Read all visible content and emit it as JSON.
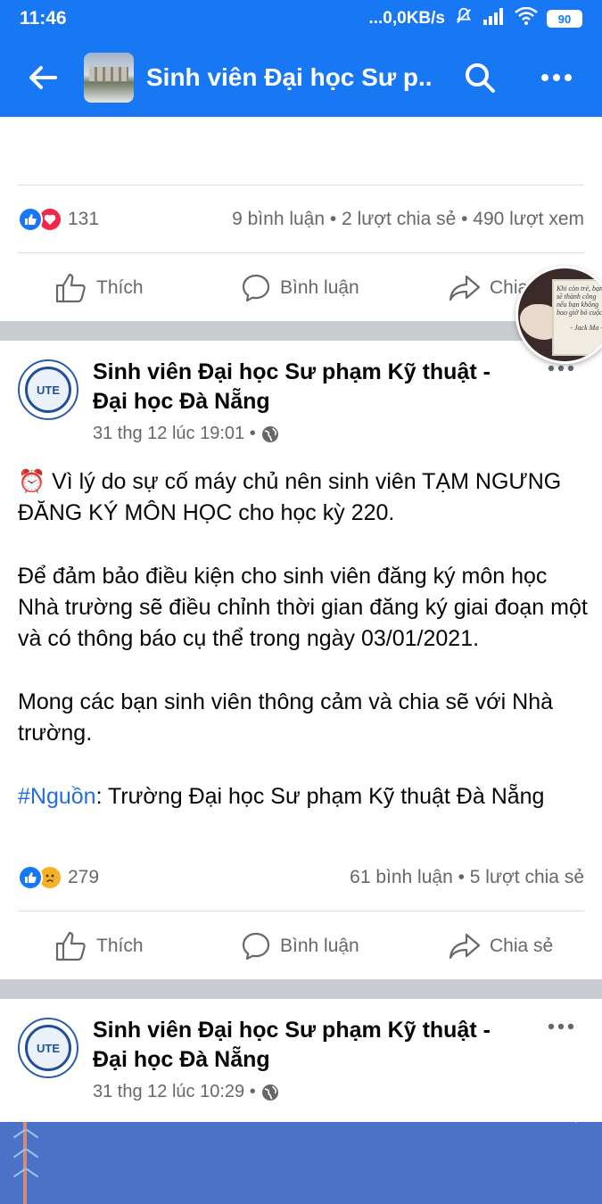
{
  "status_bar": {
    "time": "11:46",
    "network_speed": "...0,0KB/s",
    "battery": "90"
  },
  "top_bar": {
    "title": "Sinh viên Đại học Sư p..."
  },
  "post_prev": {
    "reaction_count": "131",
    "stats_right": "9 bình luận • 2 lượt chia sẻ • 490 lượt xem",
    "actions": {
      "like": "Thích",
      "comment": "Bình luận",
      "share": "Chia"
    }
  },
  "post1": {
    "author": "Sinh viên Đại học Sư phạm Kỹ thuật - Đại học Đà Nẵng",
    "timestamp": "31 thg 12 lúc 19:01 •",
    "paragraph1": "⏰ Vì lý do sự cố máy chủ nên sinh viên TẠM NGƯNG ĐĂNG KÝ MÔN HỌC cho học kỳ 220.",
    "paragraph2": "Để đảm bảo điều kiện cho sinh viên đăng ký môn học Nhà trường sẽ điều chỉnh thời gian đăng ký giai đoạn một và có thông báo cụ thể trong ngày 03/01/2021.",
    "paragraph3": "Mong các bạn sinh viên thông cảm và chia sẽ với Nhà trường.",
    "hashtag": "#Nguồn",
    "source": ": Trường Đại học Sư phạm Kỹ thuật Đà Nẵng",
    "reaction_count": "279",
    "stats_right": "61 bình luận • 5 lượt chia sẻ",
    "actions": {
      "like": "Thích",
      "comment": "Bình luận",
      "share": "Chia sẻ"
    }
  },
  "post2": {
    "author": "Sinh viên Đại học Sư phạm Kỹ thuật - Đại học Đà Nẵng",
    "timestamp": "31 thg 12 lúc 10:29 •"
  },
  "avatar_logo_text": "UTE",
  "chat_head": {
    "card_text": "Khi còn trẻ, bạn sẽ thành công nếu bạn không bao giờ bỏ cuộc",
    "card_author": "- Jack Ma -"
  },
  "colors": {
    "brand": "#1877f2",
    "like": "#1877f2",
    "love": "#f02849",
    "sad": "#f7b125",
    "hashtag": "#216fdb"
  }
}
